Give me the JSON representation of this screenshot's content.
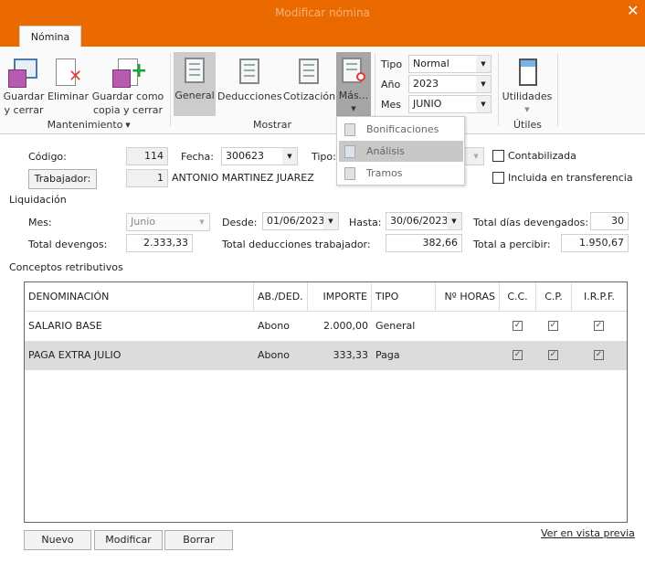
{
  "window": {
    "title": "Modificar nómina",
    "close_icon": "close-icon"
  },
  "tabs": [
    {
      "label": "Nómina"
    }
  ],
  "ribbon": {
    "groups": {
      "mantenimiento": "Mantenimiento",
      "mostrar": "Mostrar",
      "liquidacion": "Liquidación",
      "utiles": "Útiles"
    },
    "buttons": {
      "guardar_l1": "Guardar",
      "guardar_l2": "y cerrar",
      "eliminar": "Eliminar",
      "copia_l1": "Guardar como",
      "copia_l2": "copia y cerrar",
      "general": "General",
      "deducciones": "Deducciones",
      "cotizacion": "Cotización",
      "mas": "Más...",
      "utilidades": "Utilidades"
    },
    "tipo": {
      "label": "Tipo",
      "value": "Normal"
    },
    "anio": {
      "label": "Año",
      "value": "2023"
    },
    "mes": {
      "label": "Mes",
      "value": "JUNIO"
    }
  },
  "menu": {
    "items": [
      {
        "label": "Bonificaciones"
      },
      {
        "label": "Análisis",
        "highlighted": true
      },
      {
        "label": "Tramos"
      }
    ]
  },
  "form": {
    "codigo_label": "Código:",
    "codigo": "114",
    "fecha_label": "Fecha:",
    "fecha": "300623",
    "tipo_label": "Tipo:",
    "contabilizada": {
      "label": "Contabilizada",
      "checked": false
    },
    "incluida": {
      "label": "Incluida en transferencia",
      "checked": false
    },
    "trabajador_label": "Trabajador:",
    "trabajador_id": "1",
    "trabajador_nombre": "ANTONIO MARTINEZ JUAREZ"
  },
  "liquidacion": {
    "title": "Liquidación",
    "mes_label": "Mes:",
    "mes": "Junio",
    "desde_label": "Desde:",
    "desde": "01/06/2023",
    "hasta_label": "Hasta:",
    "hasta": "30/06/2023",
    "dias_label": "Total días devengados:",
    "dias": "30",
    "devengos_label": "Total devengos:",
    "devengos": "2.333,33",
    "deducciones_label": "Total deducciones trabajador:",
    "deducciones": "382,66",
    "percibir_label": "Total a percibir:",
    "percibir": "1.950,67"
  },
  "conceptos": {
    "title": "Conceptos retributivos",
    "columns": [
      "DENOMINACIÓN",
      "AB./DED.",
      "IMPORTE",
      "TIPO",
      "Nº HORAS",
      "C.C.",
      "C.P.",
      "I.R.P.F."
    ],
    "rows": [
      {
        "denominacion": "SALARIO BASE",
        "abded": "Abono",
        "importe": "2.000,00",
        "tipo": "General",
        "horas": "",
        "cc": true,
        "cp": true,
        "irpf": true
      },
      {
        "denominacion": "PAGA EXTRA JULIO",
        "abded": "Abono",
        "importe": "333,33",
        "tipo": "Paga",
        "horas": "",
        "cc": true,
        "cp": true,
        "irpf": true,
        "selected": true
      }
    ]
  },
  "footer": {
    "nuevo": "Nuevo",
    "modificar": "Modificar",
    "borrar": "Borrar",
    "vista_previa": "Ver en vista previa"
  },
  "colors": {
    "accent": "#eb6a00",
    "selected_row": "#dcdcdc"
  }
}
